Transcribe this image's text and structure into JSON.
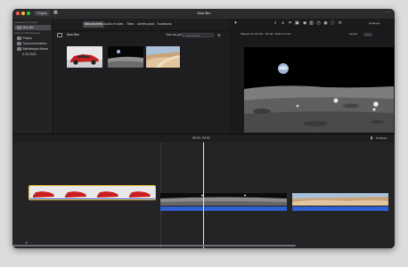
{
  "window": {
    "back_button": "Projets",
    "title": "Mon film",
    "traffic_lights": [
      "#ff5f57",
      "#febc2e",
      "#28c840"
    ]
  },
  "sidebar": {
    "header_imports": "Importées à présent",
    "header_libraries": "Liste de bibliothèques",
    "items": [
      {
        "label": "Mon film",
        "icon": "film-icon"
      },
      {
        "label": "Photos",
        "icon": "photos-icon"
      },
      {
        "label": "Tous les événeme...",
        "icon": "events-icon"
      },
      {
        "label": "Bibliothèque iMovie",
        "icon": "library-icon"
      },
      {
        "label": "6-10-2021",
        "icon": "event-icon"
      }
    ]
  },
  "browser": {
    "tabs": [
      "Mes données",
      "Audio et vidéo",
      "Titres",
      "Arrière-plans",
      "Transitions"
    ],
    "active_tab": "Mes données",
    "library_label": "Mon film",
    "filter": "Tous les plans",
    "search_placeholder": "Rechercher"
  },
  "viewer": {
    "metadata": "Masqué 07-24-202 - 25 déc. 2020 à 13:44",
    "zoom_label": "Ajuster",
    "settings_label": "Réglages"
  },
  "timeline": {
    "timecode": "00:01 / 00:51",
    "settings_label": "Réglages"
  }
}
